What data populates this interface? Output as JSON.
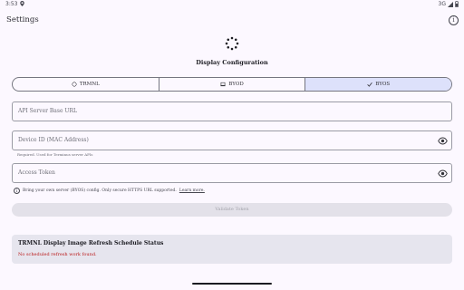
{
  "status_bar": {
    "time": "3:53",
    "network": "3G"
  },
  "app_bar": {
    "title": "Settings",
    "info_icon": "info-icon"
  },
  "heading": "Display Configuration",
  "segments": [
    {
      "label": "TRMNL",
      "icon": "trmnl-icon",
      "selected": false
    },
    {
      "label": "BYOD",
      "icon": "laptop-icon",
      "selected": false
    },
    {
      "label": "BYOS",
      "icon": "check-icon",
      "selected": true
    }
  ],
  "fields": {
    "server_url": {
      "placeholder": "API Server Base URL"
    },
    "device_id": {
      "placeholder": "Device ID (MAC Address)",
      "support": "Required. Used for Terminus server APIs"
    },
    "access_token": {
      "placeholder": "Access Token"
    }
  },
  "note": {
    "text": "Bring your own server (BYOS) config. Only secure HTTPS URL supported.",
    "link": "Learn more."
  },
  "validate_button": "Validate Token",
  "card": {
    "title": "TRMNL Display Image Refresh Schedule Status",
    "message": "No scheduled refresh work found."
  },
  "colors": {
    "background": "#fcf8ff",
    "selected_segment": "#dde1fb",
    "error": "#ba1a1a",
    "card": "#e6e5ee"
  }
}
